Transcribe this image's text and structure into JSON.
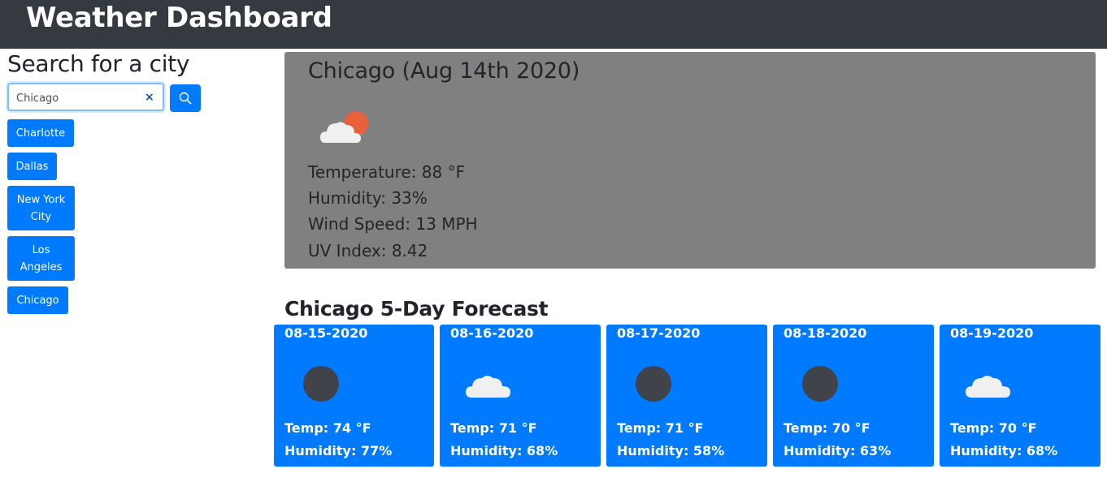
{
  "header": {
    "title": "Weather Dashboard"
  },
  "sidebar": {
    "title": "Search for a city",
    "search": {
      "value": "Chicago",
      "placeholder": ""
    },
    "clear_icon": "×",
    "cities": [
      "Charlotte",
      "Dallas",
      "New York City",
      "Los Angeles",
      "Chicago"
    ]
  },
  "current": {
    "title": "Chicago (Aug 14th 2020)",
    "icon": "partly-cloudy-icon",
    "temperature": "Temperature: 88 °F",
    "humidity": "Humidity: 33%",
    "wind": "Wind Speed: 13 MPH",
    "uv": "UV Index: 8.42"
  },
  "forecast": {
    "title": "Chicago 5-Day Forecast",
    "days": [
      {
        "date": "08-15-2020",
        "icon": "moon-icon",
        "temp": "Temp: 74 °F",
        "humidity": "Humidity: 77%"
      },
      {
        "date": "08-16-2020",
        "icon": "cloud-icon",
        "temp": "Temp: 71 °F",
        "humidity": "Humidity: 68%"
      },
      {
        "date": "08-17-2020",
        "icon": "moon-icon",
        "temp": "Temp: 71 °F",
        "humidity": "Humidity: 58%"
      },
      {
        "date": "08-18-2020",
        "icon": "moon-icon",
        "temp": "Temp: 70 °F",
        "humidity": "Humidity: 63%"
      },
      {
        "date": "08-19-2020",
        "icon": "cloud-icon",
        "temp": "Temp: 70 °F",
        "humidity": "Humidity: 68%"
      }
    ]
  },
  "colors": {
    "navbar": "#343a40",
    "primary": "#007bff",
    "current_bg": "#808080",
    "sun": "#e8603c",
    "moon": "#404349",
    "cloud": "#f0f0f0"
  }
}
